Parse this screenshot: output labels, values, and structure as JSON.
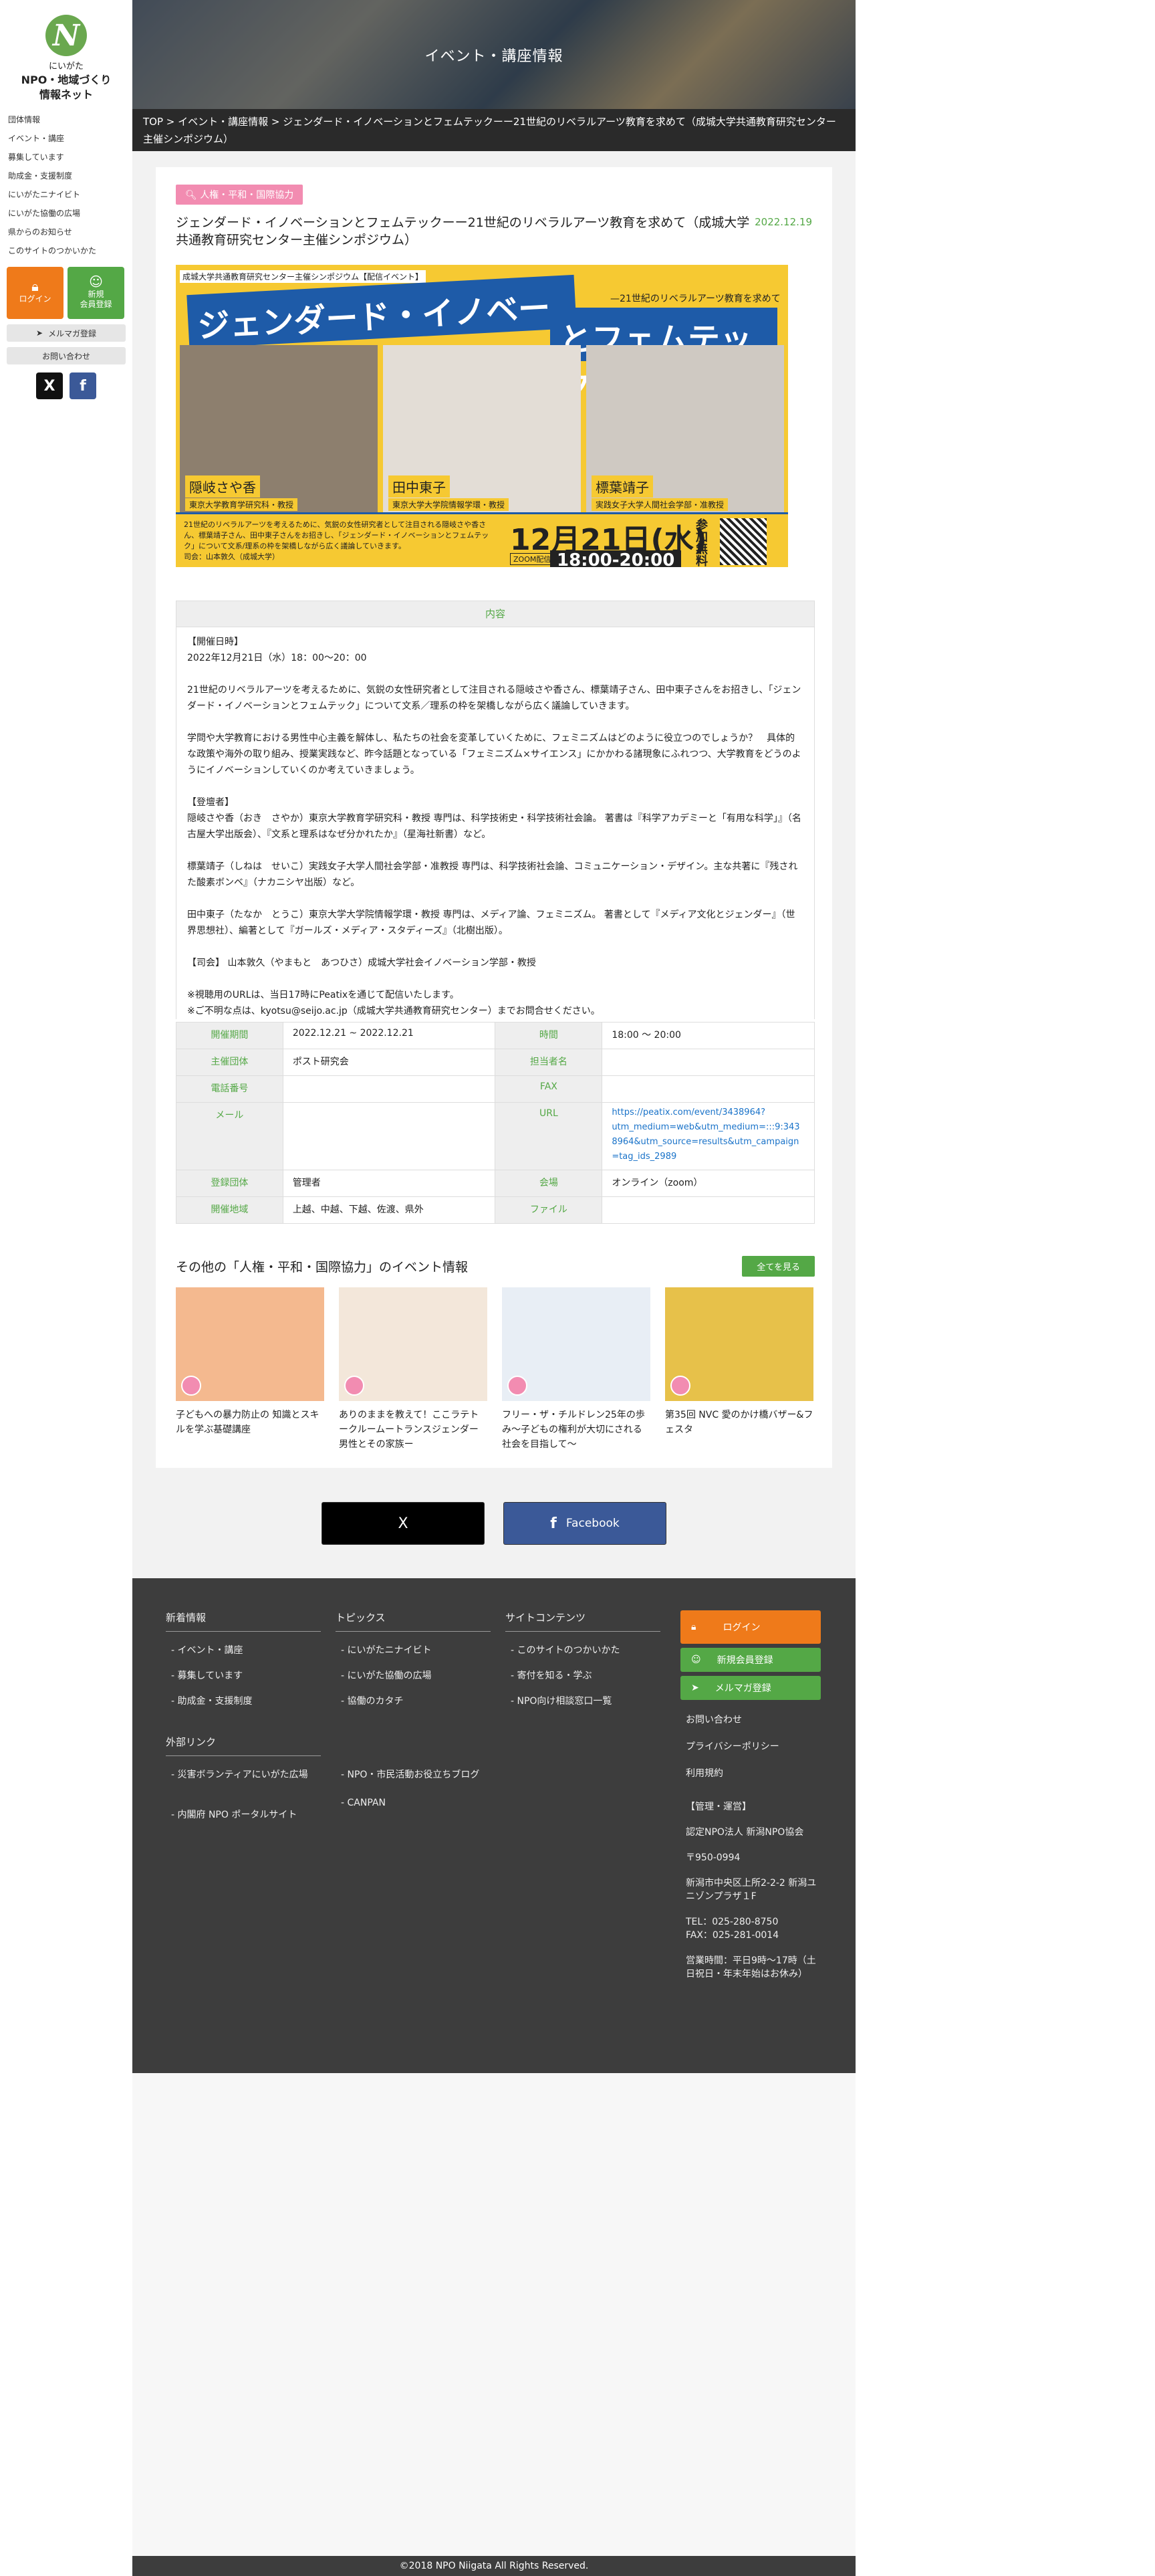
{
  "sidebar": {
    "logo_mark": "N",
    "logo_line1": "にいがた",
    "logo_line2": "NPO・地域づくり",
    "logo_line3": "情報ネット",
    "nav": [
      "団体情報",
      "イベント・講座",
      "募集しています",
      "助成金・支援制度",
      "にいがたニナイビト",
      "にいがた協働の広場",
      "県からのお知らせ",
      "このサイトのつかいかた"
    ],
    "login_label": "ログイン",
    "register_label_1": "新規",
    "register_label_2": "会員登録",
    "mailmag_label": "メルマガ登録",
    "contact_label": "お問い合わせ"
  },
  "hero": {
    "title": "イベント・講座情報"
  },
  "breadcrumb": "TOP > イベント・講座情報 > ジェンダード・イノベーションとフェムテックーー21世紀のリベラルアーツ教育を求めて（成城大学共通教育研究センター主催シンポジウム）",
  "event": {
    "category": "人権・平和・国際協力",
    "title": "ジェンダード・イノベーションとフェムテックーー21世紀のリベラルアーツ教育を求めて（成城大学共通教育研究センター主催シンポジウム）",
    "date": "2022.12.19",
    "flyer": {
      "top": "成城大学共通教育研究センター主催シンポジウム【配信イベント】",
      "title1": "ジェンダード・イノベーション",
      "title2": "とフェムテック",
      "subtitle": "—21世紀のリベラルアーツ教育を求めて",
      "p1_name": "隠岐さや香",
      "p1_role": "東京大学教育学研究科・教授",
      "p2_name": "田中東子",
      "p2_role": "東京大学大学院情報学環・教授",
      "p3_name": "標葉靖子",
      "p3_role": "実践女子大学人間社会学部・准教授",
      "desc": "21世紀のリベラルアーツを考えるために、気鋭の女性研究者として注目される隠岐さや香さん、標葉靖子さん、田中東子さんをお招きし、「ジェンダード・イノベーションとフェムテック」について文系/理系の枠を架橋しながら広く議論していきます。",
      "moderator": "司会：山本敦久（成城大学）",
      "day": "12月21日(水)",
      "time": "18:00-20:00",
      "zoom": "ZOOM配信",
      "free": "参加無料"
    },
    "content_header": "内容",
    "body": {
      "p1a": "【開催日時】",
      "p1b": "2022年12月21日（水）18：00〜20：00",
      "p2": "21世紀のリベラルアーツを考えるために、気鋭の女性研究者として注目される隠岐さや香さん、標葉靖子さん、田中東子さんをお招きし、「ジェンダード・イノベーションとフェムテック」について文系／理系の枠を架橋しながら広く議論していきます。",
      "p3": "学問や大学教育における男性中心主義を解体し、私たちの社会を変革していくために、フェミニズムはどのように役立つのでしょうか？　具体的な政策や海外の取り組み、授業実践など、昨今話題となっている「フェミニズム×サイエンス」にかかわる諸現象にふれつつ、大学教育をどうのようにイノベーションしていくのか考えていきましょう。",
      "p4a": "【登壇者】",
      "p4b": "隠岐さや香（おき　さやか）東京大学教育学研究科・教授 専門は、科学技術史・科学技術社会論。 著書は『科学アカデミーと「有用な科学」』（名古屋大学出版会）、『文系と理系はなぜ分かれたか』（星海社新書）など。",
      "p5": "標葉靖子（しねは　せいこ）実践女子大学人間社会学部・准教授 専門は、科学技術社会論、コミュニケーション・デザイン。主な共著に『残された酸素ボンベ』（ナカニシヤ出版）など。",
      "p6": "田中東子（たなか　とうこ）東京大学大学院情報学環・教授 専門は、メディア論、フェミニズム。 著書として『メディア文化とジェンダー』（世界思想社）、編著として『ガールズ・メディア・スタディーズ』（北樹出版）。",
      "p7": "【司会】 山本敦久（やまもと　あつひさ）成城大学社会イノベーション学部・教授",
      "p8a": "※視聴用のURLは、当日17時にPeatixを通じて配信いたします。",
      "p8b": "※ご不明な点は、kyotsu@seijo.ac.jp（成城大学共通教育研究センター）までお問合せください。"
    },
    "table": {
      "period_label": "開催期間",
      "period": "2022.12.21 ~ 2022.12.21",
      "time_label": "時間",
      "time": "18:00 〜 20:00",
      "org_label": "主催団体",
      "org": "ポスト研究会",
      "person_label": "担当者名",
      "person": "",
      "tel_label": "電話番号",
      "tel": "",
      "fax_label": "FAX",
      "fax": "",
      "mail_label": "メール",
      "mail": "",
      "url_label": "URL",
      "url1": "https://peatix.com/event/3438964?",
      "url2": "utm_medium=web&utm_medium=:::9:3438964&utm_source=results&utm_campaign=tag_ids_2989",
      "reg_label": "登録団体",
      "reg": "管理者",
      "venue_label": "会場",
      "venue": "オンライン（zoom）",
      "area_label": "開催地域",
      "area": "上越、中越、下越、佐渡、県外",
      "file_label": "ファイル",
      "file": ""
    }
  },
  "related": {
    "heading": "その他の「人権・平和・国際協力」のイベント情報",
    "all_button": "全てを見る",
    "items": [
      {
        "title": "子どもへの暴力防止の 知識とスキルを学ぶ基礎講座",
        "color": "#f4b98f"
      },
      {
        "title": "ありのままを教えて！ここラテトークルームートランスジェンダー男性とその家族ー",
        "color": "#f3e7da"
      },
      {
        "title": "フリー・ザ・チルドレン25年の歩み〜子どもの権利が大切にされる社会を目指して〜",
        "color": "#e8eef5"
      },
      {
        "title": "第35回 NVC 愛のかけ橋バザー&フェスタ",
        "color": "#e7c14a"
      }
    ]
  },
  "share": {
    "x_label": "X",
    "facebook_label": "Facebook"
  },
  "footer": {
    "col1_title": "新着情報",
    "col1": [
      "- イベント・講座",
      "- 募集しています",
      "- 助成金・支援制度"
    ],
    "col2_title": "トピックス",
    "col2": [
      "- にいがたニナイビト",
      "- にいがた協働の広場",
      "- 協働のカタチ"
    ],
    "col3_title": "サイトコンテンツ",
    "col3": [
      "- このサイトのつかいかた",
      "- 寄付を知る・学ぶ",
      "- NPO向け相談窓口一覧"
    ],
    "links_title": "外部リンク",
    "links": [
      "- 災害ボランティアにいがた広場",
      "- NPO・市民活動お役立ちブログ",
      "- 内閣府 NPO ポータルサイト",
      "- CANPAN"
    ],
    "login": "ログイン",
    "register": "新規会員登録",
    "mailmag": "メルマガ登録",
    "contact": "お問い合わせ",
    "privacy": "プライバシーポリシー",
    "terms": "利用規約",
    "admin_title": "【管理・運営】",
    "admin_org": "認定NPO法人 新潟NPO協会",
    "zip": "〒950-0994",
    "address": "新潟市中央区上所2-2-2 新潟ユニゾンプラザ１F",
    "tel": "TEL：025-280-8750",
    "fax": "FAX：025-281-0014",
    "hours": "営業時間：平日9時〜17時（土日祝日・年末年始はお休み）"
  },
  "copyright": "©2018 NPO Niigata All Rights Reserved.",
  "colors": {
    "green": "#54a846",
    "orange": "#ef7a1a",
    "pink": "#f28cb1",
    "dark": "#3d3d3d",
    "facebook": "#3b5998"
  }
}
